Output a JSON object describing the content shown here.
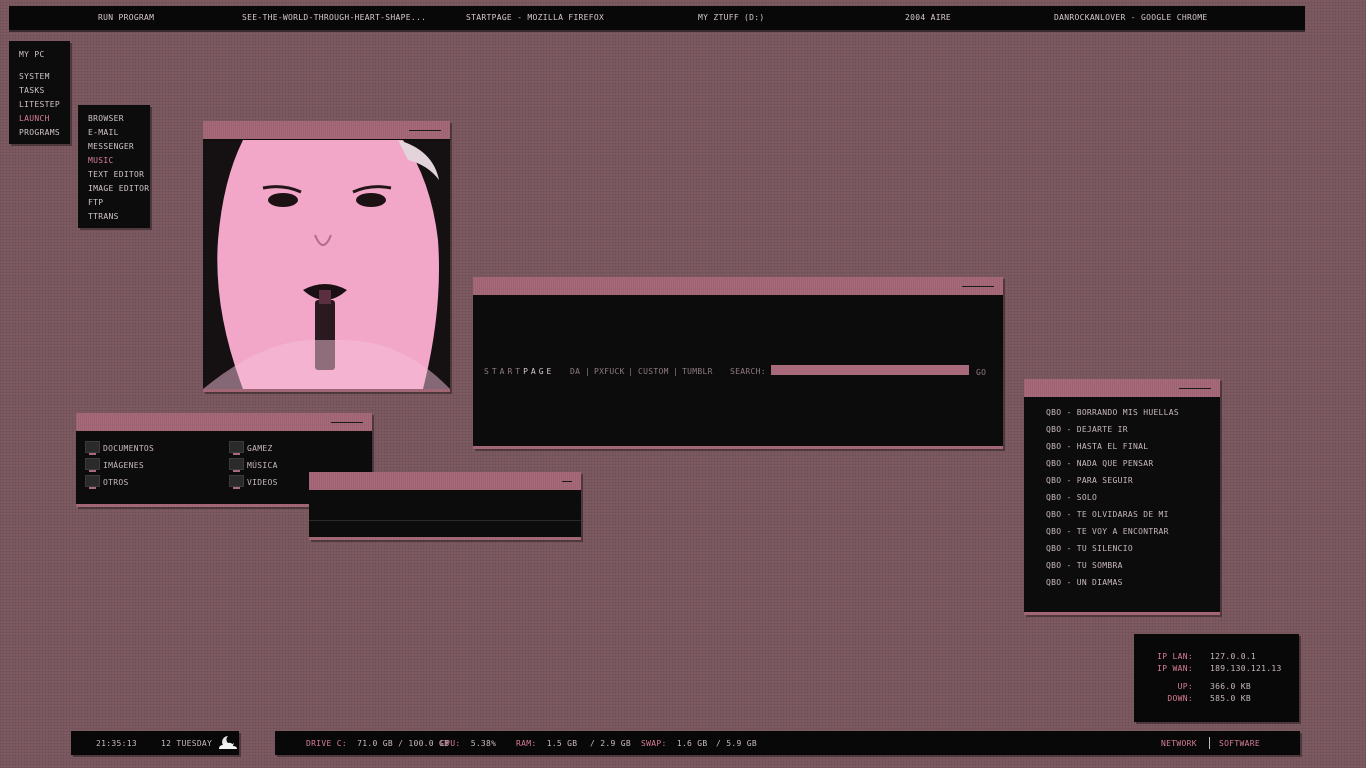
{
  "taskbar": {
    "items": [
      "RUN PROGRAM",
      "SEE-THE-WORLD-THROUGH-HEART-SHAPE...",
      "STARTPAGE - MOZILLA FIREFOX",
      "MY ZTUFF (D:)",
      "2004 AIRE",
      "DANROCKANLOVER - GOOGLE CHROME"
    ]
  },
  "main_menu": {
    "title": "MY PC",
    "items": [
      "SYSTEM",
      "TASKS",
      "LITESTEP",
      "LAUNCH",
      "PROGRAMS"
    ],
    "active": "LAUNCH"
  },
  "launch_menu": {
    "items": [
      "BROWSER",
      "E-MAIL",
      "MESSENGER",
      "MUSIC",
      "TEXT EDITOR",
      "IMAGE EDITOR",
      "FTP",
      "TTRANS"
    ],
    "active": "MUSIC"
  },
  "startpage": {
    "logo_prefix": "START",
    "logo_suffix": "PAGE",
    "links": [
      "DA",
      "|",
      "PXFUCK",
      "|",
      "CUSTOM",
      "|",
      "TUMBLR"
    ],
    "search_label": "SEARCH:",
    "search_value": "",
    "go_label": "GO"
  },
  "folders": {
    "items": [
      "DOCUMENTOS",
      "GAMEZ",
      "IMÁGENES",
      "MÚSICA",
      "OTROS",
      "VIDEOS"
    ]
  },
  "playlist": {
    "tracks": [
      "QBO - BORRANDO MIS HUELLAS",
      "QBO - DEJARTE IR",
      "QBO - HASTA EL FINAL",
      "QBO - NADA QUE PENSAR",
      "QBO - PARA SEGUIR",
      "QBO - SOLO",
      "QBO - TE OLVIDARAS DE MI",
      "QBO - TE VOY A ENCONTRAR",
      "QBO - TU SILENCIO",
      "QBO - TU SOMBRA",
      "QBO - UN DIAMAS"
    ]
  },
  "network": {
    "ip_lan_label": "IP LAN:",
    "ip_lan": "127.0.0.1",
    "ip_wan_label": "IP WAN:",
    "ip_wan": "189.130.121.13",
    "up_label": "UP:",
    "up": "366.0 KB",
    "down_label": "DOWN:",
    "down": "585.0 KB"
  },
  "clock": {
    "time": "21:35:13",
    "date": "12 TUESDAY"
  },
  "stats": {
    "drive_label": "DRIVE C:",
    "drive_value": "71.0 GB / 100.0 GB",
    "cpu_label": "CPU:",
    "cpu_value": "5.38%",
    "ram_label": "RAM:",
    "ram_used": "1.5 GB",
    "ram_total": "/ 2.9 GB",
    "swap_label": "SWAP:",
    "swap_used": "1.6 GB",
    "swap_total": "/ 5.9 GB",
    "network_link": "NETWORK",
    "software_link": "SOFTWARE"
  },
  "colors": {
    "accent": "#a86a7a",
    "highlight": "#d77e95",
    "panel": "#0c0c0c",
    "desktop": "#7d5a62"
  }
}
